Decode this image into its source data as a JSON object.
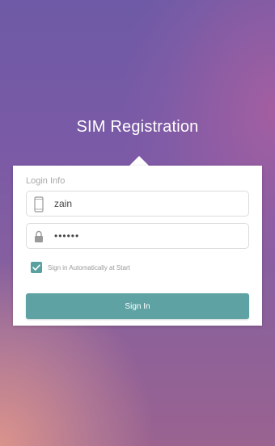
{
  "app": {
    "title": "SIM Registration"
  },
  "login": {
    "section_label": "Login Info",
    "username": {
      "value": "zain",
      "icon": "phone-icon"
    },
    "password": {
      "value": "••••••",
      "icon": "lock-icon"
    },
    "remember": {
      "label": "Sign in Automatically at Start",
      "checked": true
    },
    "submit_label": "Sign In"
  },
  "colors": {
    "accent": "#5fa2a3",
    "card": "#ffffff"
  }
}
